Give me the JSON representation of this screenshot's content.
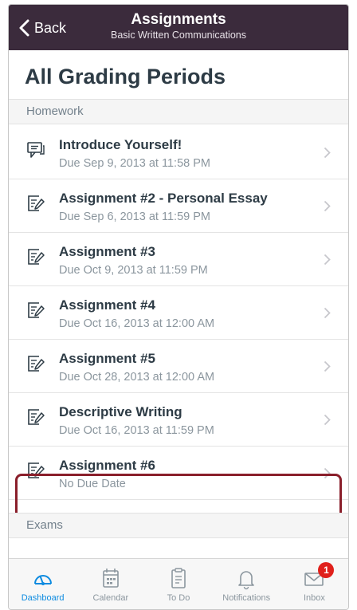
{
  "nav": {
    "back_label": "Back",
    "title": "Assignments",
    "subtitle": "Basic Written Communications"
  },
  "page_title": "All Grading Periods",
  "sections": {
    "homework": "Homework",
    "exams": "Exams"
  },
  "assignments": [
    {
      "title": "Introduce Yourself!",
      "due": "Due Sep 9, 2013 at 11:58 PM",
      "icon": "discussion-icon"
    },
    {
      "title": "Assignment #2 - Personal Essay",
      "due": "Due Sep 6, 2013 at 11:59 PM",
      "icon": "assignment-icon"
    },
    {
      "title": "Assignment #3",
      "due": "Due Oct 9, 2013 at 11:59 PM",
      "icon": "assignment-icon"
    },
    {
      "title": "Assignment #4",
      "due": "Due Oct 16, 2013 at 12:00 AM",
      "icon": "assignment-icon"
    },
    {
      "title": "Assignment #5",
      "due": "Due Oct 28, 2013 at 12:00 AM",
      "icon": "assignment-icon"
    },
    {
      "title": "Descriptive Writing",
      "due": "Due Oct 16, 2013 at 11:59 PM",
      "icon": "assignment-icon"
    },
    {
      "title": "Assignment #6",
      "due": "No Due Date",
      "icon": "assignment-icon"
    }
  ],
  "tabbar": {
    "items": [
      {
        "label": "Dashboard",
        "icon": "dashboard-icon",
        "active": true
      },
      {
        "label": "Calendar",
        "icon": "calendar-icon"
      },
      {
        "label": "To Do",
        "icon": "todo-icon"
      },
      {
        "label": "Notifications",
        "icon": "bell-icon"
      },
      {
        "label": "Inbox",
        "icon": "inbox-icon",
        "badge": "1"
      }
    ]
  },
  "colors": {
    "navbar": "#3b2b3c",
    "active_tab": "#0d8be0",
    "highlight": "#8a1f2b",
    "badge": "#e0201b"
  }
}
